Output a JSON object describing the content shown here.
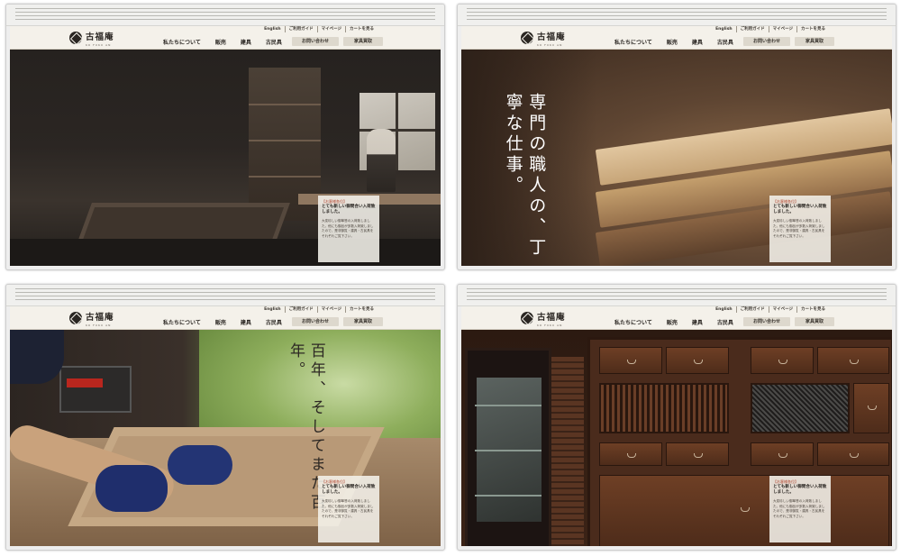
{
  "site": {
    "logo_text": "古福庵",
    "logo_sub": "KO FUKU AN",
    "util_links": [
      "English",
      "ご利用ガイド",
      "マイページ",
      "カートを見る"
    ],
    "nav": [
      "私たちについて",
      "販売",
      "建具",
      "古民具"
    ],
    "contact_button": "お問い合わせ",
    "buyback_button": "家具買取"
  },
  "news": {
    "tag": "【お客様各位】",
    "title": "とても新しい御問合い入荷致しました。",
    "body": "大変珍しい御箪笥の入荷致しました。他にも御品が多数入荷致しましたので、是非御覧・建具・古民具をそれぞれご覧下さい。"
  },
  "panels": [
    {
      "id": "workshop"
    },
    {
      "id": "timber",
      "catch": "専門の職人の、丁寧な仕事。"
    },
    {
      "id": "craftsman",
      "catch": "百年、そしてまた百年。"
    },
    {
      "id": "furniture"
    }
  ]
}
